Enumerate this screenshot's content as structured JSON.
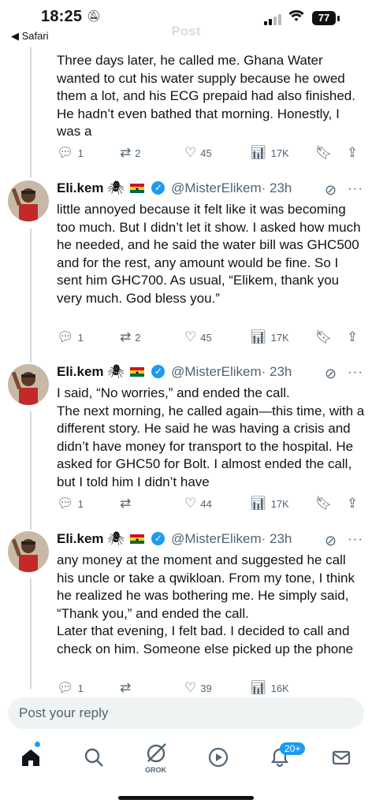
{
  "status_bar": {
    "time": "18:25",
    "back_app": "◀ Safari",
    "battery": "77",
    "title": "Post"
  },
  "tweets": [
    {
      "text": "Three days later, he called me. Ghana Water wanted to cut his water supply because he owed them a lot, and his ECG prepaid had also finished. He hadn’t even bathed that morning. Honestly, I was a",
      "replies": "1",
      "reposts": "2",
      "likes": "45",
      "views": "17K"
    },
    {
      "name": "Eli.kem",
      "handle": "@MisterElikem",
      "time": "· 23h",
      "text": "little annoyed because it felt like it was becoming too much. But I didn’t let it show. I asked how much he needed, and he said the water bill was GHC500 and for the rest, any amount would be fine. So I sent him GHC700. As usual, “Elikem, thank you very much. God bless you.”",
      "replies": "1",
      "reposts": "2",
      "likes": "45",
      "views": "17K"
    },
    {
      "name": "Eli.kem",
      "handle": "@MisterElikem",
      "time": "· 23h",
      "text": "I said, “No worries,” and ended the call.\nThe next morning, he called again—this time, with a different story. He said he was having a crisis and didn’t have money for transport to the hospital. He asked for GHC50 for Bolt. I almost ended the call, but I told him I didn’t have",
      "replies": "1",
      "reposts": "",
      "likes": "44",
      "views": "17K"
    },
    {
      "name": "Eli.kem",
      "handle": "@MisterElikem",
      "time": "· 23h",
      "text": "any money at the moment and suggested he call his uncle or take a qwikloan. From my tone, I think he realized he was bothering me. He simply said, “Thank you,” and ended the call.\nLater that evening, I felt bad. I decided to call and check on him. Someone else picked up the phone",
      "replies": "1",
      "reposts": "",
      "likes": "39",
      "views": "16K"
    }
  ],
  "reply_placeholder": "Post your reply",
  "tab_bar": {
    "grok_label": "GROK",
    "notifications_badge": "20+"
  }
}
